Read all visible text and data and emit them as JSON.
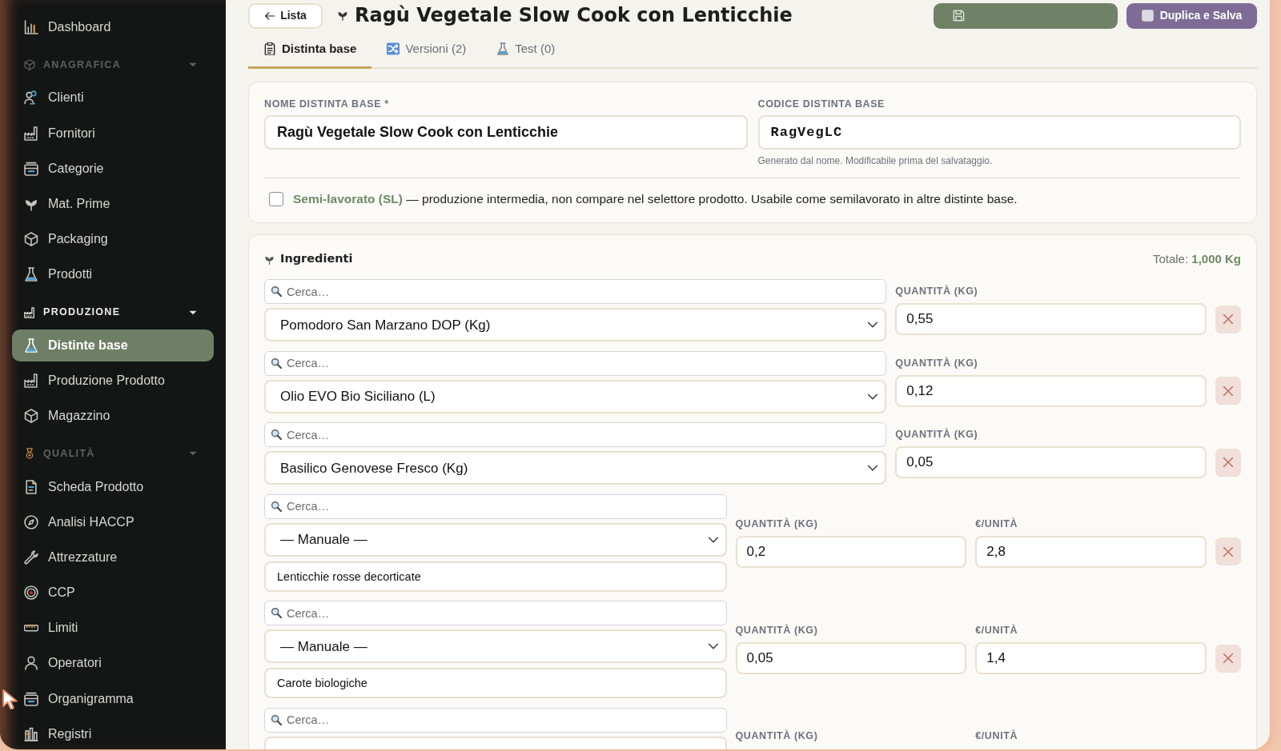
{
  "sidebar": {
    "items": [
      {
        "kind": "link",
        "label": "Dashboard",
        "selected": false
      },
      {
        "kind": "section",
        "label": "ANAGRAFICA",
        "active": false,
        "expanded": true
      },
      {
        "kind": "link",
        "label": "Clienti",
        "selected": false
      },
      {
        "kind": "link",
        "label": "Fornitori",
        "selected": false
      },
      {
        "kind": "link",
        "label": "Categorie",
        "selected": false
      },
      {
        "kind": "link",
        "label": "Mat. Prime",
        "selected": false
      },
      {
        "kind": "link",
        "label": "Packaging",
        "selected": false
      },
      {
        "kind": "link",
        "label": "Prodotti",
        "selected": false
      },
      {
        "kind": "section",
        "label": "PRODUZIONE",
        "active": true,
        "expanded": true
      },
      {
        "kind": "link",
        "label": "Distinte base",
        "selected": true
      },
      {
        "kind": "link",
        "label": "Produzione Prodotto",
        "selected": false
      },
      {
        "kind": "link",
        "label": "Magazzino",
        "selected": false
      },
      {
        "kind": "section",
        "label": "QUALITÀ",
        "active": false,
        "expanded": true
      },
      {
        "kind": "link",
        "label": "Scheda Prodotto",
        "selected": false
      },
      {
        "kind": "link",
        "label": "Analisi HACCP",
        "selected": false
      },
      {
        "kind": "link",
        "label": "Attrezzature",
        "selected": false
      },
      {
        "kind": "link",
        "label": "CCP",
        "selected": false
      },
      {
        "kind": "link",
        "label": "Limiti",
        "selected": false
      },
      {
        "kind": "link",
        "label": "Operatori",
        "selected": false
      },
      {
        "kind": "link",
        "label": "Organigramma",
        "selected": false
      },
      {
        "kind": "link",
        "label": "Registri",
        "selected": false
      }
    ]
  },
  "header": {
    "back_button": "Lista",
    "title": "Ragù Vegetale Slow Cook con Lenticchie",
    "buttons": [
      {
        "kind": "save"
      },
      {
        "kind": "duplicate",
        "label": "Duplica e Salva"
      }
    ]
  },
  "tabs": [
    {
      "label": "Distinta base",
      "selected": true
    },
    {
      "label": "Versioni (2)",
      "selected": false
    },
    {
      "label": "Test (0)",
      "selected": false
    }
  ],
  "details": {
    "name_field": {
      "label": "NOME DISTINTA BASE *",
      "value": "Ragù Vegetale Slow Cook con Lenticchie"
    },
    "code_field": {
      "label": "CODICE DISTINTA BASE",
      "value": "RagVegLC",
      "help": "Generato dal nome. Modificabile prima del salvataggio."
    },
    "semi_finished": {
      "checked": false,
      "text": "**Semi-lavorato (SL)** — produzione intermedia, non compare nel selettore prodotto. Usabile come semilavorato in altre distinte base."
    }
  },
  "ingredients": {
    "title": "Ingredienti",
    "total": "Totale: **1,000 Kg**",
    "rows": [
      {
        "kind": "catalog",
        "search_placeholder": "Cerca…",
        "selection": "Pomodoro San Marzano DOP (Kg)",
        "quantity_label": "QUANTITÀ (KG)",
        "quantity": "0,55"
      },
      {
        "kind": "catalog",
        "search_placeholder": "Cerca…",
        "selection": "Olio EVO Bio Siciliano (L)",
        "quantity_label": "QUANTITÀ (KG)",
        "quantity": "0,12"
      },
      {
        "kind": "catalog",
        "search_placeholder": "Cerca…",
        "selection": "Basilico Genovese Fresco (Kg)",
        "quantity_label": "QUANTITÀ (KG)",
        "quantity": "0,05"
      },
      {
        "kind": "manual",
        "search_placeholder": "Cerca…",
        "selection": "— Manuale —",
        "name": "Lenticchie rosse decorticate",
        "quantity_label": "QUANTITÀ (KG)",
        "quantity": "0,2",
        "price_label": "€/UNITÀ",
        "price": "2,8"
      },
      {
        "kind": "manual",
        "search_placeholder": "Cerca…",
        "selection": "— Manuale —",
        "name": "Carote biologiche",
        "quantity_label": "QUANTITÀ (KG)",
        "quantity": "0,05",
        "price_label": "€/UNITÀ",
        "price": "1,4"
      },
      {
        "kind": "manual",
        "search_placeholder": "Cerca…",
        "quantity_label": "QUANTITÀ (KG)",
        "price_label": "€/UNITÀ"
      }
    ]
  }
}
